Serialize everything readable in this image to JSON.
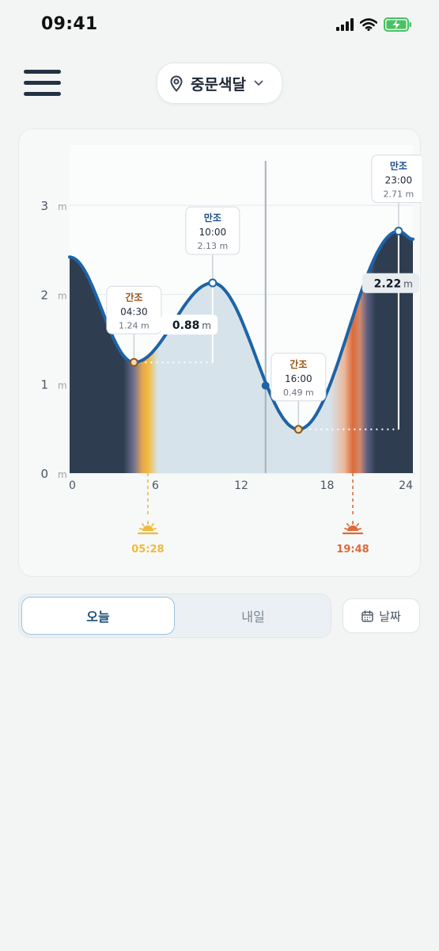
{
  "status_bar": {
    "time": "09:41"
  },
  "location": {
    "name": "중문색달"
  },
  "chart_data": {
    "type": "line",
    "x_ticks": [
      "0",
      "6",
      "12",
      "18",
      "24"
    ],
    "y_ticks": [
      "0",
      "1",
      "2",
      "3"
    ],
    "y_unit": "m",
    "xlim": [
      0,
      24
    ],
    "ylim": [
      0,
      3
    ],
    "tide_points": [
      {
        "kind": "low",
        "label": "간조",
        "time": "04:30",
        "hour": 4.5,
        "height": 1.24,
        "height_label": "1.24 m"
      },
      {
        "kind": "high",
        "label": "만조",
        "time": "10:00",
        "hour": 10,
        "height": 2.13,
        "height_label": "2.13 m"
      },
      {
        "kind": "low",
        "label": "간조",
        "time": "16:00",
        "hour": 16,
        "height": 0.49,
        "height_label": "0.49 m"
      },
      {
        "kind": "high",
        "label": "만조",
        "time": "23:00",
        "hour": 23,
        "height": 2.71,
        "height_label": "2.71 m"
      }
    ],
    "start_height": 2.42,
    "end_height": 2.62,
    "current": {
      "hour": 13.7,
      "height": 0.98
    },
    "differences": [
      {
        "value": "0.88",
        "unit": "m"
      },
      {
        "value": "2.22",
        "unit": "m"
      }
    ],
    "sunrise": {
      "time": "05:28",
      "hour": 5.47,
      "color": "#f2b93b"
    },
    "sunset": {
      "time": "19:48",
      "hour": 19.8,
      "color": "#de6a3a"
    },
    "colors": {
      "curve": "#1e63a6",
      "night": "#2e3e50",
      "day": "#d6e3ea"
    }
  },
  "tabs": {
    "today": "오늘",
    "tomorrow": "내일"
  },
  "date_button": {
    "label": "날짜"
  },
  "icons": {
    "menu": "hamburger-menu-icon",
    "location": "map-pin-icon",
    "dropdown": "chevron-down-icon",
    "calendar": "calendar-icon"
  }
}
